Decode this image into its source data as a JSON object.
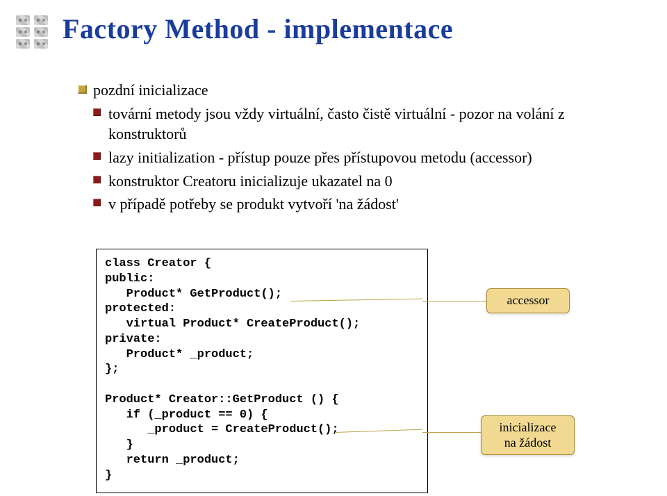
{
  "title": "Factory Method - implementace",
  "bullets": {
    "b1": "pozdní inicializace",
    "sub": [
      "tovární metody jsou vždy virtuální, často čistě virtuální - pozor na volání z konstruktorů",
      "lazy initialization - přístup pouze přes přístupovou metodu (accessor)",
      "konstruktor Creatoru inicializuje ukazatel na 0",
      "v případě potřeby se produkt vytvoří 'na žádost'"
    ]
  },
  "code": "class Creator {\npublic:\n   Product* GetProduct();\nprotected:\n   virtual Product* CreateProduct();\nprivate:\n   Product* _product;\n};\n\nProduct* Creator::GetProduct () {\n   if (_product == 0) {\n      _product = CreateProduct();\n   }\n   return _product;\n}",
  "callouts": {
    "accessor": "accessor",
    "lazy": "inicializace\nna žádost"
  }
}
